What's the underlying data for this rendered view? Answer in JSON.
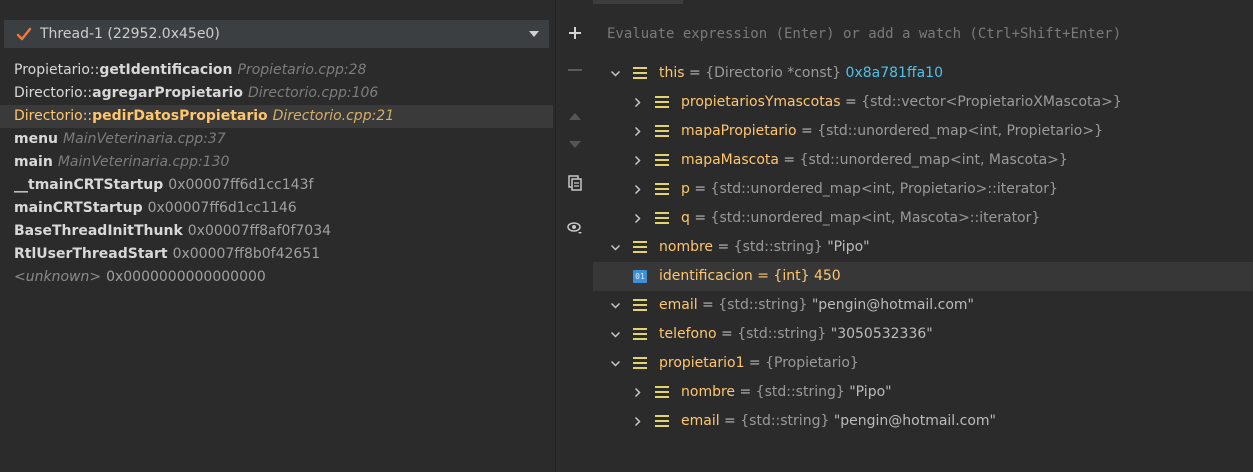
{
  "thread": {
    "label": "Thread-1 (22952.0x45e0)"
  },
  "frames": [
    {
      "fn": "Propietario::",
      "fn_bold": "getIdentificacion",
      "loc": "Propietario.cpp:28"
    },
    {
      "fn": "Directorio::",
      "fn_bold": "agregarPropietario",
      "loc": "Directorio.cpp:106"
    },
    {
      "fn": "Directorio::",
      "fn_bold": "pedirDatosPropietario",
      "loc": "Directorio.cpp:21"
    },
    {
      "fn": "",
      "fn_bold": "menu",
      "loc": "MainVeterinaria.cpp:37"
    },
    {
      "fn": "",
      "fn_bold": "main",
      "loc": "MainVeterinaria.cpp:130"
    },
    {
      "fn": "",
      "fn_bold": "__tmainCRTStartup",
      "addr": "0x00007ff6d1cc143f"
    },
    {
      "fn": "",
      "fn_bold": "mainCRTStartup",
      "addr": "0x00007ff6d1cc1146"
    },
    {
      "fn": "",
      "fn_bold": "BaseThreadInitThunk",
      "addr": "0x00007ff8af0f7034"
    },
    {
      "fn": "",
      "fn_bold": "RtlUserThreadStart",
      "addr": "0x00007ff8b0f42651"
    },
    {
      "unknown": "<unknown>",
      "addr": "0x0000000000000000"
    }
  ],
  "watch": {
    "placeholder": "Evaluate expression (Enter) or add a watch (Ctrl+Shift+Enter)"
  },
  "variables": [
    {
      "name": "this",
      "type": "{Directorio *const}",
      "value": "0x8a781ffa10"
    },
    {
      "name": "propietariosYmascotas",
      "type": "{std::vector<PropietarioXMascota>}",
      "value": ""
    },
    {
      "name": "mapaPropietario",
      "type": "{std::unordered_map<int, Propietario>}",
      "value": ""
    },
    {
      "name": "mapaMascota",
      "type": "{std::unordered_map<int, Mascota>}",
      "value": ""
    },
    {
      "name": "p",
      "type": "{std::unordered_map<int, Propietario>::iterator}",
      "value": ""
    },
    {
      "name": "q",
      "type": "{std::unordered_map<int, Mascota>::iterator}",
      "value": ""
    },
    {
      "name": "nombre",
      "type": "{std::string}",
      "value": "\"Pipo\""
    },
    {
      "name": "identificacion",
      "type": "{int}",
      "value": "450"
    },
    {
      "name": "email",
      "type": "{std::string}",
      "value": "\"pengin@hotmail.com\""
    },
    {
      "name": "telefono",
      "type": "{std::string}",
      "value": "\"3050532336\""
    },
    {
      "name": "propietario1",
      "type": "{Propietario}",
      "value": ""
    },
    {
      "name": "nombre",
      "type": "{std::string}",
      "value": "\"Pipo\""
    },
    {
      "name": "email",
      "type": "{std::string}",
      "value": "\"pengin@hotmail.com\""
    }
  ],
  "primitive_badge": "01",
  "colors": {
    "accent_name": "#ffc66d",
    "hex_value": "#4fc1e9",
    "struct_icon": "#e4d36b",
    "check": "#ef7b3e"
  },
  "icons": [
    "check-icon",
    "chevron-down-icon",
    "plus-icon",
    "minus-icon",
    "arrow-up-icon",
    "arrow-down-icon",
    "duplicate-icon",
    "watch-eye-icon",
    "chevron-right-icon",
    "struct-icon",
    "primitive-icon"
  ]
}
